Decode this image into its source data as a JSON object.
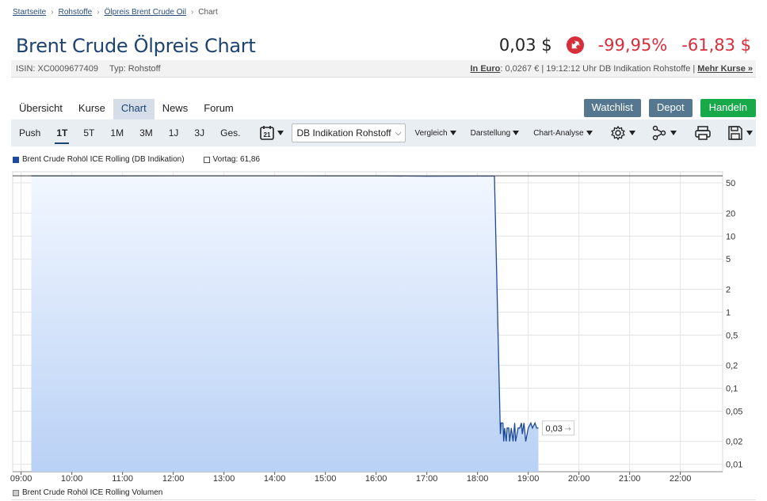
{
  "breadcrumb": [
    "Startseite",
    "Rohstoffe",
    "Ölpreis Brent Crude Oil",
    "Chart"
  ],
  "title": "Brent Crude Ölpreis Chart",
  "quote": {
    "price": "0,03 $",
    "change_pct": "-99,95%",
    "change_abs": "-61,83 $",
    "down_color": "#d62e3a"
  },
  "info": {
    "isin": "ISIN: XC0009677409",
    "typ": "Typ: Rohstoff",
    "euro_label": "In Euro",
    "euro_rest": ": 0,0267 € | 19:12:12 Uhr DB Indikation Rohstoffe | ",
    "mehr": "Mehr Kurse »"
  },
  "tabs": [
    "Übersicht",
    "Kurse",
    "Chart",
    "News",
    "Forum"
  ],
  "actions": {
    "watchlist": "Watchlist",
    "depot": "Depot",
    "handeln": "Handeln"
  },
  "toolbar": {
    "ranges": [
      "Push",
      "1T",
      "5T",
      "1M",
      "3M",
      "1J",
      "3J",
      "Ges."
    ],
    "calendar_day": "21",
    "exchange": "DB Indikation Rohstoffe",
    "vergleich": "Vergleich",
    "darstellung": "Darstellung",
    "analyse": "Chart-Analyse"
  },
  "legend": {
    "series": "Brent Crude Rohöl ICE Rolling (DB Indikation)",
    "vortag": "Vortag: 61,86",
    "volume": "Brent Crude Rohöl ICE Rolling Volumen"
  },
  "chart_data": {
    "type": "area",
    "scale": "log",
    "ylim": [
      0.008,
      70
    ],
    "y_ticks": [
      50,
      20,
      10,
      5,
      2,
      1,
      0.5,
      0.2,
      0.1,
      0.05,
      0.02,
      0.01
    ],
    "y_tick_labels": [
      "50",
      "20",
      "10",
      "5",
      "2",
      "1",
      "0,5",
      "0,2",
      "0,1",
      "0,05",
      "0,02",
      "0,01"
    ],
    "x_ticks": [
      "09:00",
      "10:00",
      "11:00",
      "12:00",
      "13:00",
      "14:00",
      "15:00",
      "16:00",
      "17:00",
      "18:00",
      "19:00",
      "20:00",
      "21:00",
      "22:00"
    ],
    "xlim": [
      "08:50",
      "22:50"
    ],
    "reference_line": {
      "label": "Vortag",
      "value": 61.86
    },
    "last_value_label": "0,03",
    "line_color": "#1d4a9c",
    "fill_color": "#b9d1f5",
    "series": [
      {
        "name": "Brent Crude Rohöl ICE Rolling (DB Indikation)",
        "points": [
          [
            "09:12",
            61.8
          ],
          [
            "10:00",
            61.8
          ],
          [
            "11:00",
            61.85
          ],
          [
            "12:00",
            61.9
          ],
          [
            "13:00",
            61.9
          ],
          [
            "14:00",
            61.9
          ],
          [
            "15:00",
            61.85
          ],
          [
            "16:00",
            61.8
          ],
          [
            "17:00",
            61.2
          ],
          [
            "18:00",
            61.3
          ],
          [
            "18:20",
            61.3
          ],
          [
            "18:27",
            0.025
          ],
          [
            "18:28",
            0.035
          ],
          [
            "18:30",
            0.035
          ],
          [
            "18:31",
            0.02
          ],
          [
            "18:32",
            0.03
          ],
          [
            "18:34",
            0.02
          ],
          [
            "18:35",
            0.03
          ],
          [
            "18:37",
            0.03
          ],
          [
            "18:38",
            0.02
          ],
          [
            "18:40",
            0.03
          ],
          [
            "18:42",
            0.02
          ],
          [
            "18:44",
            0.035
          ],
          [
            "18:45",
            0.02
          ],
          [
            "18:48",
            0.03
          ],
          [
            "18:50",
            0.03
          ],
          [
            "18:52",
            0.035
          ],
          [
            "18:53",
            0.025
          ],
          [
            "18:55",
            0.035
          ],
          [
            "18:57",
            0.02
          ],
          [
            "19:00",
            0.03
          ],
          [
            "19:03",
            0.035
          ],
          [
            "19:05",
            0.03
          ],
          [
            "19:08",
            0.035
          ],
          [
            "19:10",
            0.03
          ],
          [
            "19:12",
            0.03
          ]
        ]
      }
    ]
  }
}
